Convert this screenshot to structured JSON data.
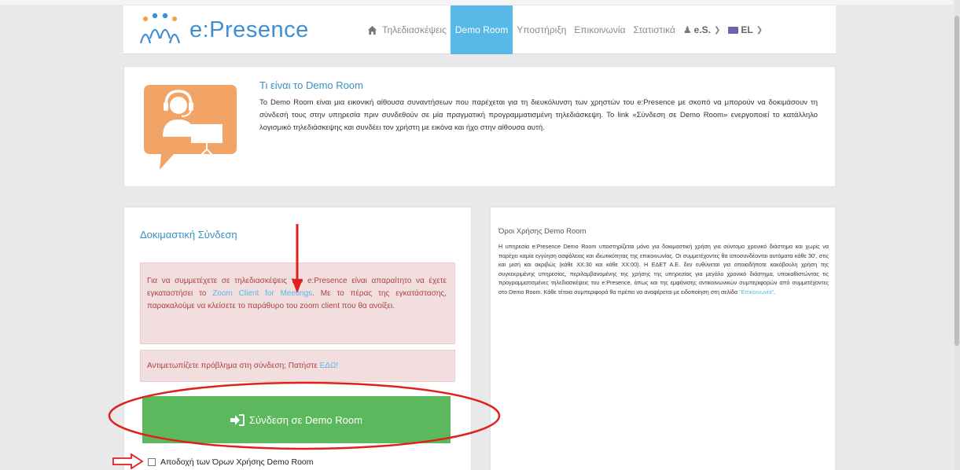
{
  "brand": {
    "logo_text": "e:Presence",
    "brand_color": "#3c8fd6"
  },
  "nav": {
    "home_icon": "home-icon",
    "items": [
      {
        "label": "Τηλεδιασκέψεις",
        "active": false
      },
      {
        "label": "Demo Room",
        "active": true
      },
      {
        "label": "Υποστήριξη",
        "active": false
      },
      {
        "label": "Επικοινωνία",
        "active": false
      },
      {
        "label": "Στατιστικά",
        "active": false
      }
    ],
    "user_label": "e.S.",
    "lang_label": "EL",
    "active_color": "#58b8e8"
  },
  "intro": {
    "title": "Τι είναι το Demo Room",
    "text": "Το Demo Room είναι μια εικονική αίθουσα συναντήσεων που παρέχεται για τη διευκόλυνση των χρηστών του e:Presence με σκοπό να μπορούν να δοκιμάσουν τη σύνδεσή τους στην υπηρεσία πριν συνδεθούν σε μία πραγματική προγραμματισμένη τηλεδιάσκεψη. Το link «Σύνδεση σε Demo Room» ενεργοποιεί το κατάλληλο λογισμικό τηλεδιάσκεψης και συνδέει τον χρήστη με εικόνα και ήχο στην αίθουσα αυτή.",
    "illustration": "headset-presenter-icon"
  },
  "test_connection": {
    "title": "Δοκιμαστική Σύνδεση",
    "alert_1": {
      "before": "Για να συμμετέχετε σε τηλεδιασκέψεις του e:Presence είναι απαραίτητο να έχετε εγκαταστήσει το ",
      "link": "Zoom Client for Meetings",
      "after": ". Με το πέρας της εγκατάστασης, παρακαλούμε να κλείσετε το παράθυρο του zoom client που θα ανοίξει."
    },
    "alert_2": {
      "before": "Αντιμετωπίζετε πρόβλημα στη σύνδεση; Πατήστε ",
      "link": "ΕΔΩ!"
    },
    "connect_button": "Σύνδεση σε Demo Room",
    "accept_label": "Αποδοχή των Όρων Χρήσης Demo Room",
    "button_color": "#5cb85c",
    "alert_bg": "#f2dede"
  },
  "terms": {
    "title": "Όροι Χρήσης Demo Room",
    "text": "Η υπηρεσία e:Presence Demo Room υποστηρίζεται μόνο για δοκιμαστική χρήση για σύντομο χρονικό διάστημα και χωρίς να παρέχει καμία εγγύηση ασφάλειας και ιδιωτικότητας της επικοινωνίας. Οι συμμετέχοντες θα αποσυνδέονται αυτόματα κάθε 30', στις και μισή και ακριβώς (κάθε XX:30 και κάθε XX:00). Η ΕΔΕΤ Α.Ε. δεν ευθύνεται για οποιαδήποτε κακόβουλη χρήση της συγκεκριμένης υπηρεσίας, περιλαμβανομένης της χρήσης της υπηρεσίας για μεγάλο χρονικό διάστημα, υποκαθιστώντας τις προγραμματισμένες τηλεδιασκέψεις του e:Presence, όπως και της εμφάνισης αντικοινωνικών συμπεριφορών από συμμετέχοντες στο Demo Room. Κάθε τέτοια συμπεριφορά θα πρέπει να αναφέρεται με ειδοποίηση στη σελίδα ",
    "link": "\"Επικοινωνία\"",
    "end": "."
  },
  "annotation_color": "#e0201c"
}
